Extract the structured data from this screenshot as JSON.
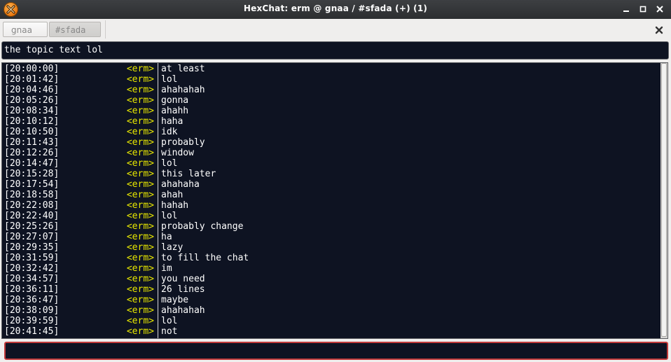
{
  "window": {
    "title": "HexChat: erm @ gnaa / #sfada (+) (1)",
    "icons": {
      "app": "hexchat-app-icon",
      "minimize": "minimize-icon",
      "maximize": "maximize-icon",
      "close": "close-icon"
    }
  },
  "tabs": [
    {
      "label": "gnaa",
      "active": false
    },
    {
      "label": "#sfada",
      "active": true
    }
  ],
  "topic": {
    "text": "the topic text lol"
  },
  "colors": {
    "chat_bg": "#0e1322",
    "nick": "#e8e800",
    "text": "#ffffff",
    "input_border": "#c23b3b"
  },
  "messages": [
    {
      "time": "[20:00:00]",
      "nick": "<erm>",
      "text": "at least"
    },
    {
      "time": "[20:01:42]",
      "nick": "<erm>",
      "text": "lol"
    },
    {
      "time": "[20:04:46]",
      "nick": "<erm>",
      "text": "ahahahah"
    },
    {
      "time": "[20:05:26]",
      "nick": "<erm>",
      "text": "gonna"
    },
    {
      "time": "[20:08:34]",
      "nick": "<erm>",
      "text": "ahahh"
    },
    {
      "time": "[20:10:12]",
      "nick": "<erm>",
      "text": "haha"
    },
    {
      "time": "[20:10:50]",
      "nick": "<erm>",
      "text": "idk"
    },
    {
      "time": "[20:11:43]",
      "nick": "<erm>",
      "text": "probably"
    },
    {
      "time": "[20:12:26]",
      "nick": "<erm>",
      "text": "window"
    },
    {
      "time": "[20:14:47]",
      "nick": "<erm>",
      "text": "lol"
    },
    {
      "time": "[20:15:28]",
      "nick": "<erm>",
      "text": "this later"
    },
    {
      "time": "[20:17:54]",
      "nick": "<erm>",
      "text": "ahahaha"
    },
    {
      "time": "[20:18:58]",
      "nick": "<erm>",
      "text": "ahah"
    },
    {
      "time": "[20:22:08]",
      "nick": "<erm>",
      "text": "hahah"
    },
    {
      "time": "[20:22:40]",
      "nick": "<erm>",
      "text": "lol"
    },
    {
      "time": "[20:25:26]",
      "nick": "<erm>",
      "text": "probably change"
    },
    {
      "time": "[20:27:07]",
      "nick": "<erm>",
      "text": "ha"
    },
    {
      "time": "[20:29:35]",
      "nick": "<erm>",
      "text": "lazy"
    },
    {
      "time": "[20:31:59]",
      "nick": "<erm>",
      "text": "to fill the chat"
    },
    {
      "time": "[20:32:42]",
      "nick": "<erm>",
      "text": "im"
    },
    {
      "time": "[20:34:57]",
      "nick": "<erm>",
      "text": "you need"
    },
    {
      "time": "[20:36:11]",
      "nick": "<erm>",
      "text": "26 lines"
    },
    {
      "time": "[20:36:47]",
      "nick": "<erm>",
      "text": "maybe"
    },
    {
      "time": "[20:38:09]",
      "nick": "<erm>",
      "text": "ahahahah"
    },
    {
      "time": "[20:39:59]",
      "nick": "<erm>",
      "text": "lol"
    },
    {
      "time": "[20:41:45]",
      "nick": "<erm>",
      "text": "not"
    }
  ],
  "input": {
    "value": "",
    "placeholder": ""
  }
}
